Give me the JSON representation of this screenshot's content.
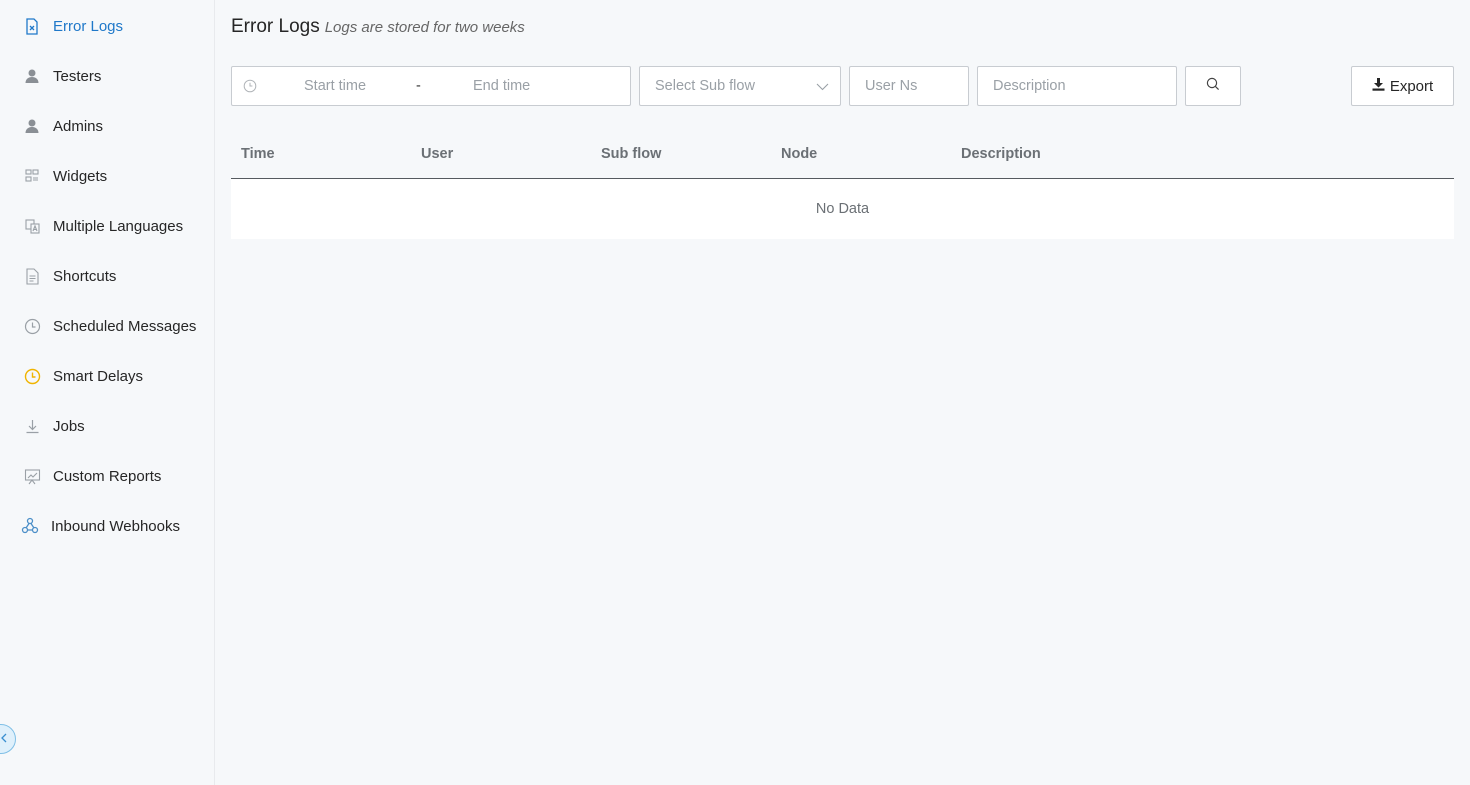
{
  "sidebar": {
    "items": [
      {
        "label": "Error Logs",
        "icon": "error-file-icon",
        "active": true
      },
      {
        "label": "Testers",
        "icon": "person-icon"
      },
      {
        "label": "Admins",
        "icon": "person-icon"
      },
      {
        "label": "Widgets",
        "icon": "widget-icon"
      },
      {
        "label": "Multiple Languages",
        "icon": "translate-icon"
      },
      {
        "label": "Shortcuts",
        "icon": "document-icon"
      },
      {
        "label": "Scheduled Messages",
        "icon": "clock-icon"
      },
      {
        "label": "Smart Delays",
        "icon": "clock-yellow-icon"
      },
      {
        "label": "Jobs",
        "icon": "download-icon"
      },
      {
        "label": "Custom Reports",
        "icon": "report-board-icon"
      },
      {
        "label": "Inbound Webhooks",
        "icon": "webhook-icon"
      }
    ],
    "collapse_icon": "chevron-left-icon"
  },
  "header": {
    "title": "Error Logs",
    "subtitle": "Logs are stored for two weeks"
  },
  "filters": {
    "start_placeholder": "Start time",
    "separator": "-",
    "end_placeholder": "End time",
    "subflow_placeholder": "Select Sub flow",
    "userns_placeholder": "User Ns",
    "description_placeholder": "Description",
    "export_label": "Export"
  },
  "table": {
    "columns": [
      "Time",
      "User",
      "Sub flow",
      "Node",
      "Description"
    ],
    "empty_text": "No Data"
  },
  "colors": {
    "accent": "#1f78c9",
    "smart_delay_icon": "#f0b400"
  }
}
